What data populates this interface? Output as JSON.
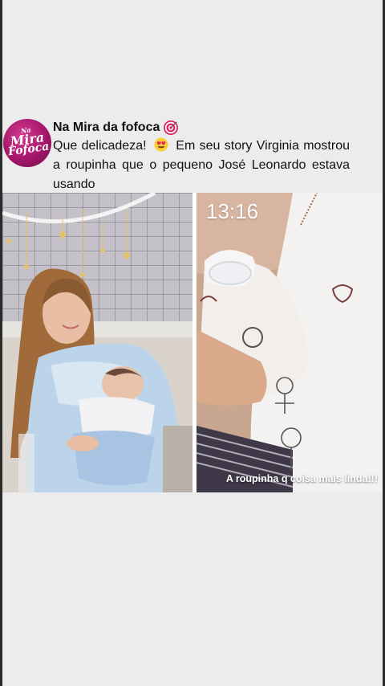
{
  "post": {
    "author": "Na Mira da fofoca",
    "author_icon": "target-emoji-icon",
    "avatar": {
      "logo_line1": "Na",
      "logo_line2": "Mira",
      "logo_line3": "Fofoca",
      "bg_color": "#a3166a"
    },
    "caption_part1": "Que delicadeza!",
    "caption_emoji": "heart-eyes-emoji-icon",
    "caption_part2": "Em seu story Virginia mostrou a roupinha que o pequeno José Leonardo estava usando"
  },
  "photos": {
    "left": {
      "subject": "mother-holding-newborn-photo"
    },
    "right": {
      "subject": "baby-outfit-story-photo",
      "story_time": "13:16",
      "story_caption": "A roupinha q coisa mais linda!!!"
    }
  },
  "colors": {
    "background": "#ececec",
    "text": "#111111"
  }
}
